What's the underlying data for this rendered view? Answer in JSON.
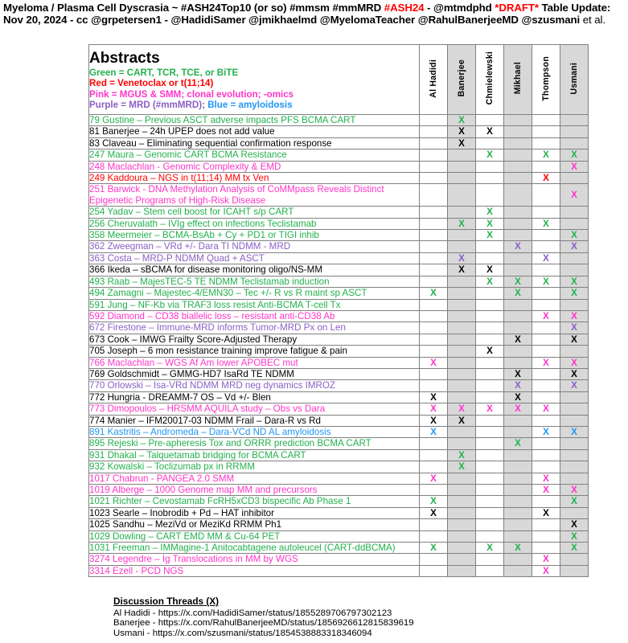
{
  "caption": {
    "line1_a": "Myeloma / Plasma Cell Dyscrasia ~ #ASH24Top10 (or so) #mmsm #mmMRD ",
    "line1_hash": "#ASH24",
    "line1_b": " - @mtmdphd ",
    "line1_draft": "*DRAFT*",
    "line1_c": " Table Update: Nov 20, 2024 - cc @grpetersen1 - @HadidiSamer @jmikhaelmd @MyelomaTeacher @RahulBanerjeeMD @szusmani",
    "line1_tail": " et al."
  },
  "legend": {
    "title": "Abstracts",
    "lines": [
      {
        "text": "Green = CART, TCR, TCE, or BiTE",
        "color": "green"
      },
      {
        "text": "Red = Venetoclax or t(11;14)",
        "color": "red"
      },
      {
        "text": "Pink = MGUS & SMM; clonal evolution; -omics",
        "color": "pink"
      }
    ],
    "line4_a": "Purple = MRD (#mmMRD); ",
    "line4_b": "Blue = amyloidosis"
  },
  "columns": [
    {
      "label": "Al Hadidi",
      "shaded": false
    },
    {
      "label": "Banerjee",
      "shaded": true
    },
    {
      "label": "Chmielewski",
      "shaded": false
    },
    {
      "label": "Mikhael",
      "shaded": true
    },
    {
      "label": "Thompson",
      "shaded": false
    },
    {
      "label": "Usmani",
      "shaded": true
    }
  ],
  "mark": "X",
  "rows": [
    {
      "title": "79 Gustine – Previous ASCT adverse impacts PFS BCMA CART",
      "color": "green",
      "marks": [
        "",
        "X",
        "",
        "",
        "",
        ""
      ]
    },
    {
      "title": "81 Banerjee – 24h UPEP does not add value",
      "color": "black",
      "marks": [
        "",
        "X",
        "X",
        "",
        "",
        ""
      ]
    },
    {
      "title": "83 Claveau – Eliminating sequential confirmation response",
      "color": "black",
      "marks": [
        "",
        "X",
        "",
        "",
        "",
        ""
      ]
    },
    {
      "title": "247 Maura – Genomic CART BCMA Resistance",
      "color": "green",
      "marks": [
        "",
        "",
        "X",
        "",
        "X",
        "X"
      ]
    },
    {
      "title": "248 Maclachlan - Genomic Complexity & EMD",
      "color": "pink",
      "marks": [
        "",
        "",
        "",
        "",
        "",
        "X"
      ]
    },
    {
      "title": "249 Kaddoura – NGS in t(11;14) MM tx Ven",
      "color": "red",
      "marks": [
        "",
        "",
        "",
        "",
        "X",
        ""
      ]
    },
    {
      "title": "251 Barwick - DNA Methylation Analysis of CoMMpass Reveals Distinct Epigenetic Programs of High-Risk Disease",
      "color": "pink",
      "tall": true,
      "marks": [
        "",
        "",
        "",
        "",
        "",
        "X"
      ]
    },
    {
      "title": "254 Yadav – Stem cell boost for ICAHT s/p CART",
      "color": "green",
      "marks": [
        "",
        "",
        "X",
        "",
        "",
        ""
      ]
    },
    {
      "title": "256 Cheruvalath – IVIg effect on infections Teclistamab",
      "color": "green",
      "marks": [
        "",
        "X",
        "X",
        "",
        "X",
        ""
      ]
    },
    {
      "title": "358 Meermeier – BCMA-BsAb + Cy + PD1 or TIGI inhib",
      "color": "green",
      "marks": [
        "",
        "",
        "X",
        "",
        "",
        "X"
      ]
    },
    {
      "title": "362 Zweegman – VRd +/- Dara TI NDMM - MRD",
      "color": "purple",
      "marks": [
        "",
        "",
        "",
        "X",
        "",
        "X"
      ]
    },
    {
      "title": "363 Costa – MRD-P NDMM Quad + ASCT",
      "color": "purple",
      "marks": [
        "",
        "X",
        "",
        "",
        "X",
        ""
      ]
    },
    {
      "title": "366 Ikeda – sBCMA for disease monitoring oligo/NS-MM",
      "color": "black",
      "marks": [
        "",
        "X",
        "X",
        "",
        "",
        ""
      ]
    },
    {
      "title": "493 Raab – MajesTEC-5 TE NDMM Teclistamab induction",
      "color": "green",
      "marks": [
        "",
        "",
        "X",
        "X",
        "X",
        "X"
      ]
    },
    {
      "title": "494 Zamagni – Majestec-4/EMN30 – Tec +/- R vs R  maint sp ASCT",
      "color": "green",
      "marks": [
        "X",
        "",
        "",
        "X",
        "",
        "X"
      ]
    },
    {
      "title": "591 Jung – NF-Kb via TRAF3 loss resist Anti-BCMA T-cell Tx",
      "color": "green",
      "marks": [
        "",
        "",
        "",
        "",
        "",
        ""
      ]
    },
    {
      "title": "592 Diamond – CD38 biallelic loss – resistant anti-CD38 Ab",
      "color": "pink",
      "marks": [
        "",
        "",
        "",
        "",
        "X",
        "X"
      ]
    },
    {
      "title": "672 Firestone – Immune-MRD informs Tumor-MRD Px on Len",
      "color": "purple",
      "marks": [
        "",
        "",
        "",
        "",
        "",
        "X"
      ]
    },
    {
      "title": "673 Cook – IMWG Frailty Score-Adjusted Therapy",
      "color": "black",
      "marks": [
        "",
        "",
        "",
        "X",
        "",
        "X"
      ]
    },
    {
      "title": "705 Joseph – 6 mon resistance training improve fatigue & pain",
      "color": "black",
      "marks": [
        "",
        "",
        "X",
        "",
        "",
        ""
      ]
    },
    {
      "title": "766 Maclachlan – WGS Af Am lower APOBEC mut",
      "color": "pink",
      "marks": [
        "X",
        "",
        "",
        "",
        "X",
        "X"
      ]
    },
    {
      "title": "769 Goldschmidt – GMMG-HD7 IsaRd TE NDMM",
      "color": "black",
      "marks": [
        "",
        "",
        "",
        "X",
        "",
        "X"
      ]
    },
    {
      "title": "770 Orlowski – Isa-VRd NDMM MRD neg dynamics IMROZ",
      "color": "purple",
      "marks": [
        "",
        "",
        "",
        "X",
        "",
        "X"
      ]
    },
    {
      "title": "772 Hungria - DREAMM-7 OS – Vd +/- Blen",
      "color": "black",
      "marks": [
        "X",
        "",
        "",
        "X",
        "",
        ""
      ]
    },
    {
      "title": "773 Dimopoulos – HRSMM AQUILA study – Obs vs Dara",
      "color": "pink",
      "marks": [
        "X",
        "X",
        "X",
        "X",
        "X",
        ""
      ]
    },
    {
      "title": "774 Manier – IFM20017-03 NDMM Frail – Dara-R vs Rd",
      "color": "black",
      "marks": [
        "X",
        "X",
        "",
        "",
        "",
        ""
      ]
    },
    {
      "title": "891 Kastritis – Andromeda – Dara-VCd ND AL amyloidosis",
      "color": "blue",
      "marks": [
        "X",
        "",
        "",
        "",
        "X",
        "X"
      ]
    },
    {
      "title": "895 Rejeski – Pre-apheresis Tox and ORRR prediction BCMA CART",
      "color": "green",
      "marks": [
        "",
        "",
        "",
        "X",
        "",
        ""
      ]
    },
    {
      "title": "931 Dhakal – Talquetamab bridging for BCMA CART",
      "color": "green",
      "marks": [
        "",
        "X",
        "",
        "",
        "",
        ""
      ]
    },
    {
      "title": "932 Kowalski – Toclizumab px in RRMM",
      "color": "green",
      "marks": [
        "",
        "X",
        "",
        "",
        "",
        ""
      ]
    },
    {
      "title": "1017 Chabrun - PANGEA 2.0 SMM",
      "color": "pink",
      "marks": [
        "X",
        "",
        "",
        "",
        "X",
        ""
      ]
    },
    {
      "title": "1019 Alberge – 1000 Genome map MM and precursors",
      "color": "pink",
      "marks": [
        "",
        "",
        "",
        "",
        "X",
        "X"
      ]
    },
    {
      "title": "1021 Richter – Cevostamab FcRH5xCD3 bispecific Ab Phase 1",
      "color": "green",
      "marks": [
        "X",
        "",
        "",
        "",
        "",
        "X"
      ]
    },
    {
      "title": "1023 Searle – Inobrodib + Pd – HAT inhibitor",
      "color": "black",
      "marks": [
        "X",
        "",
        "",
        "",
        "X",
        ""
      ]
    },
    {
      "title": "1025 Sandhu – MeziVd  or MeziKd RRMM Ph1",
      "color": "black",
      "marks": [
        "",
        "",
        "",
        "",
        "",
        "X"
      ]
    },
    {
      "title": "1029 Dowling – CART EMD MM & Cu-64 PET",
      "color": "green",
      "marks": [
        "",
        "",
        "",
        "",
        "",
        "X"
      ]
    },
    {
      "title": "1031 Freeman – IMMagine-1 Anitocabtagene autoleucel (CART-ddBCMA)",
      "color": "green",
      "marks": [
        "X",
        "",
        "X",
        "X",
        "",
        "X"
      ]
    },
    {
      "title": "3274 Legendre – Ig Translocations in MM by WGS",
      "color": "pink",
      "marks": [
        "",
        "",
        "",
        "",
        "X",
        ""
      ]
    },
    {
      "title": "3314 Ezell - PCD NGS",
      "color": "pink",
      "marks": [
        "",
        "",
        "",
        "",
        "X",
        ""
      ]
    }
  ],
  "footer": {
    "heading": "Discussion Threads (X)",
    "links": [
      "Al Hadidi - https://x.com/HadidiSamer/status/1855289706797302123",
      "Banerjee - https://x.com/RahulBanerjeeMD/status/1856926612815839619",
      "Usmani - https://x.com/szusmani/status/1854538883318346094"
    ]
  },
  "colors": {
    "green": "#22b14c",
    "red": "#ff0000",
    "pink": "#ff34c8",
    "purple": "#8a5fc4",
    "blue": "#2196f3",
    "black": "#000000",
    "shade": "#d8d8d8",
    "border": "#808080"
  }
}
